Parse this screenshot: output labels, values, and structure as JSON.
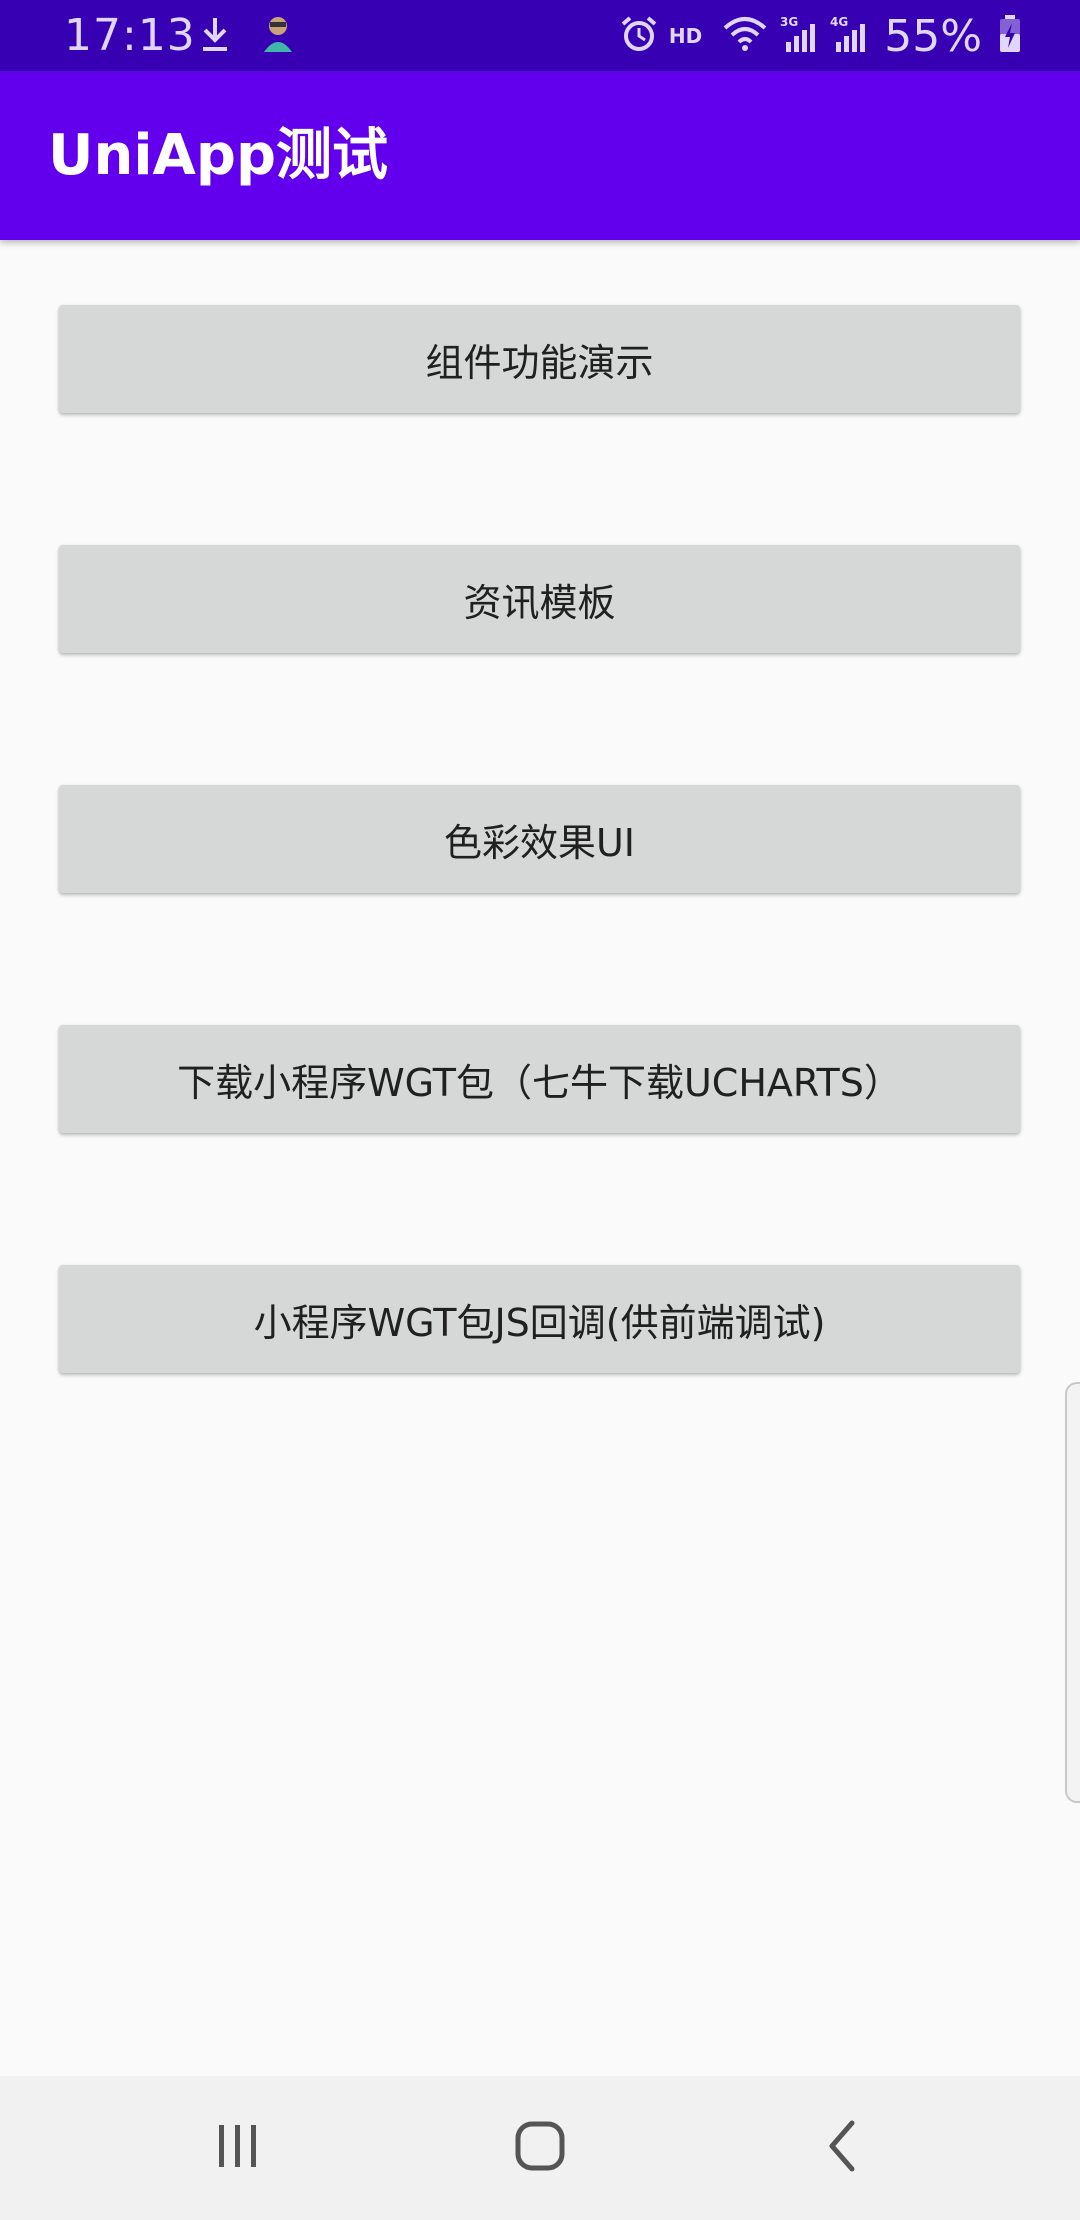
{
  "status_bar": {
    "time": "17:13",
    "hd": "HD",
    "battery": "55%",
    "icons": [
      "download-icon",
      "app-notification-icon",
      "alarm-icon",
      "wifi-icon",
      "signal-3g-icon",
      "signal-4g-icon",
      "battery-charging-icon"
    ],
    "background": "#3700b3"
  },
  "app_bar": {
    "title": "UniApp测试",
    "background": "#6200ee"
  },
  "buttons": [
    {
      "label": "组件功能演示"
    },
    {
      "label": "资讯模板"
    },
    {
      "label": "色彩效果UI"
    },
    {
      "label": "下载小程序WGT包（七牛下载UCHARTS）"
    },
    {
      "label": "小程序WGT包JS回调(供前端调试)"
    }
  ],
  "nav_bar": {
    "icons": [
      "recent-apps-icon",
      "home-icon",
      "back-icon"
    ]
  }
}
